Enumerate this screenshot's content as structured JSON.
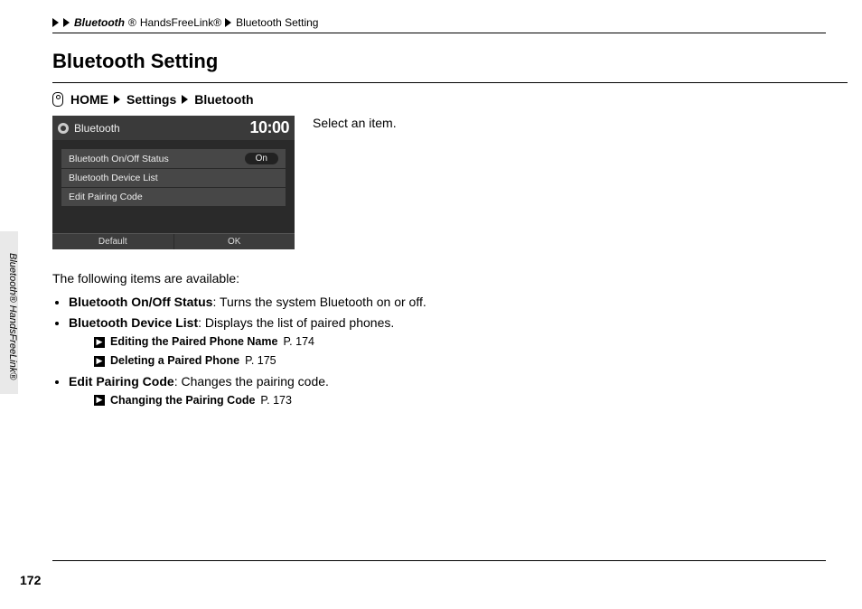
{
  "runhead": {
    "part1_italic": "Bluetooth",
    "part1_reg": "®",
    "part2": "HandsFreeLink®",
    "part3": "Bluetooth Setting"
  },
  "side_label": {
    "italic": "Bluetooth",
    "rest": "® HandsFreeLink®"
  },
  "title": "Bluetooth Setting",
  "nav": {
    "home": "HOME",
    "settings": "Settings",
    "bluetooth": "Bluetooth"
  },
  "screen": {
    "title": "Bluetooth",
    "time": "10:00",
    "rows": [
      {
        "label": "Bluetooth On/Off Status",
        "value": "On"
      },
      {
        "label": "Bluetooth Device List",
        "value": ""
      },
      {
        "label": "Edit Pairing Code",
        "value": ""
      }
    ],
    "btn_left": "Default",
    "btn_right": "OK"
  },
  "instruction": "Select an item.",
  "intro": "The following items are available:",
  "items": [
    {
      "name": "Bluetooth On/Off Status",
      "desc": ": Turns the system Bluetooth on or off.",
      "subs": []
    },
    {
      "name": "Bluetooth Device List",
      "desc": ": Displays the list of paired phones.",
      "subs": [
        {
          "title": "Editing the Paired Phone Name",
          "page": "P. 174"
        },
        {
          "title": "Deleting a Paired Phone",
          "page": "P. 175"
        }
      ]
    },
    {
      "name": "Edit Pairing Code",
      "desc": ": Changes the pairing code.",
      "subs": [
        {
          "title": "Changing the Pairing Code",
          "page": "P. 173"
        }
      ]
    }
  ],
  "page_number": "172"
}
